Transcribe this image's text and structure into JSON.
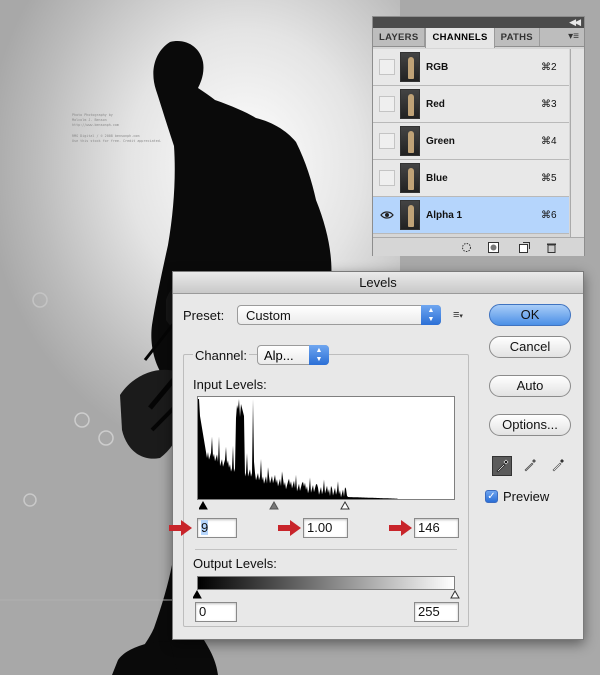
{
  "credit_text": "Photo Photography by\nMalcolm J. Benson\nhttp://www.bensonph.com\n\nRMG Digital / © 2008 bensonph.com\nUse this stock for free. Credit appreciated.",
  "channels_panel": {
    "tabs": [
      "LAYERS",
      "CHANNELS",
      "PATHS"
    ],
    "active_tab": "CHANNELS",
    "rows": [
      {
        "name": "RGB",
        "shortcut": "⌘2",
        "visible": false,
        "selected": false
      },
      {
        "name": "Red",
        "shortcut": "⌘3",
        "visible": false,
        "selected": false
      },
      {
        "name": "Green",
        "shortcut": "⌘4",
        "visible": false,
        "selected": false
      },
      {
        "name": "Blue",
        "shortcut": "⌘5",
        "visible": false,
        "selected": false
      },
      {
        "name": "Alpha 1",
        "shortcut": "⌘6",
        "visible": true,
        "selected": true
      }
    ],
    "footer_icons": [
      "load-selection-icon",
      "save-selection-icon",
      "new-channel-icon",
      "delete-channel-icon"
    ]
  },
  "levels": {
    "title": "Levels",
    "preset_label": "Preset:",
    "preset_value": "Custom",
    "channel_label": "Channel:",
    "channel_value": "Alp...",
    "input_levels_label": "Input Levels:",
    "input_black": "9",
    "input_gamma": "1.00",
    "input_white": "146",
    "output_levels_label": "Output Levels:",
    "output_black": "0",
    "output_white": "255",
    "buttons": {
      "ok": "OK",
      "cancel": "Cancel",
      "auto": "Auto",
      "options": "Options..."
    },
    "preview_label": "Preview",
    "preview_checked": true,
    "eyedroppers": [
      "black-point-eyedropper-icon",
      "gray-point-eyedropper-icon",
      "white-point-eyedropper-icon"
    ],
    "highlight_arrow_color": "#c8242a",
    "accent_color": "#3b7de0",
    "selection_color": "#b5d5fc"
  }
}
